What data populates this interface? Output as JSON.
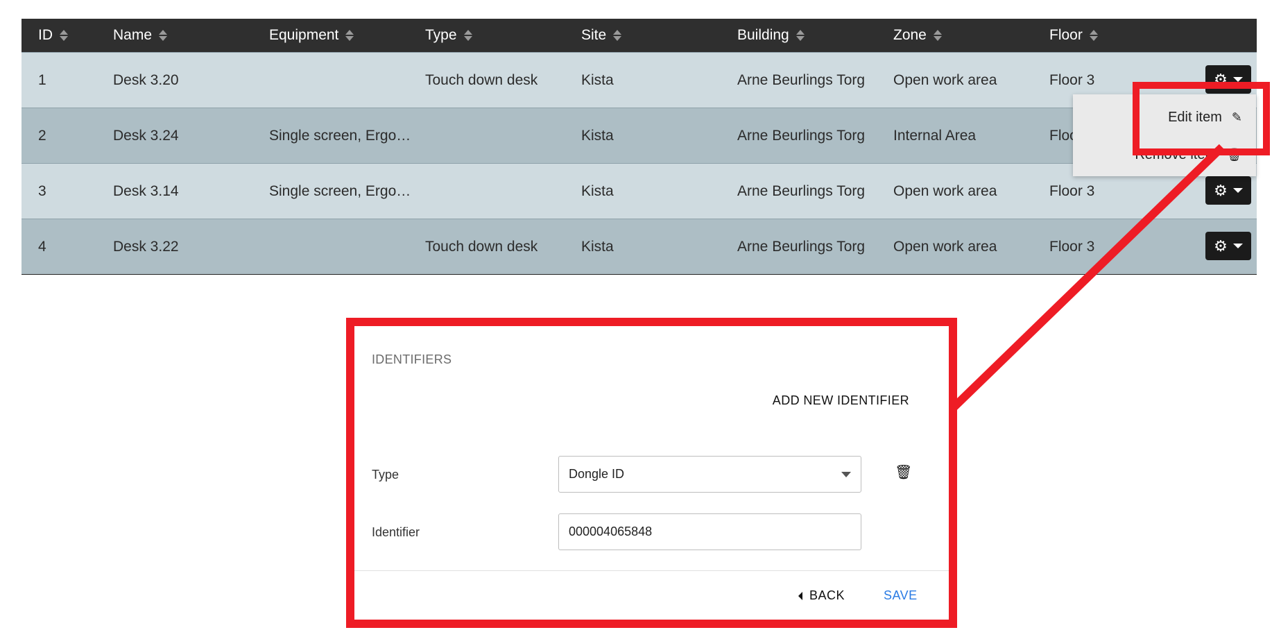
{
  "table": {
    "columns": [
      "ID",
      "Name",
      "Equipment",
      "Type",
      "Site",
      "Building",
      "Zone",
      "Floor"
    ],
    "rows": [
      {
        "id": "1",
        "name": "Desk 3.20",
        "equipment": "",
        "type": "Touch down desk",
        "site": "Kista",
        "building": "Arne Beurlings Torg",
        "zone": "Open work area",
        "floor": "Floor 3"
      },
      {
        "id": "2",
        "name": "Desk 3.24",
        "equipment": "Single screen, Ergo…",
        "type": "",
        "site": "Kista",
        "building": "Arne Beurlings Torg",
        "zone": "Internal Area",
        "floor": "Floor 3"
      },
      {
        "id": "3",
        "name": "Desk 3.14",
        "equipment": "Single screen, Ergo…",
        "type": "",
        "site": "Kista",
        "building": "Arne Beurlings Torg",
        "zone": "Open work area",
        "floor": "Floor 3"
      },
      {
        "id": "4",
        "name": "Desk 3.22",
        "equipment": "",
        "type": "Touch down desk",
        "site": "Kista",
        "building": "Arne Beurlings Torg",
        "zone": "Open work area",
        "floor": "Floor 3"
      }
    ],
    "actions_icon": "gear-icon"
  },
  "menu": {
    "edit_label": "Edit item",
    "remove_label": "Remove item",
    "edit_icon": "edit-icon",
    "remove_icon": "trash-icon"
  },
  "form": {
    "section_title": "IDENTIFIERS",
    "add_new_label": "ADD NEW IDENTIFIER",
    "type_label": "Type",
    "type_value": "Dongle ID",
    "identifier_label": "Identifier",
    "identifier_value": "000004065848",
    "back_label": "BACK",
    "save_label": "SAVE"
  },
  "colors": {
    "header_bg": "#2f2f2f",
    "row_light": "#cfdbe0",
    "row_dark": "#adbec5",
    "highlight": "#ee1c25",
    "save_blue": "#2a7be4"
  }
}
